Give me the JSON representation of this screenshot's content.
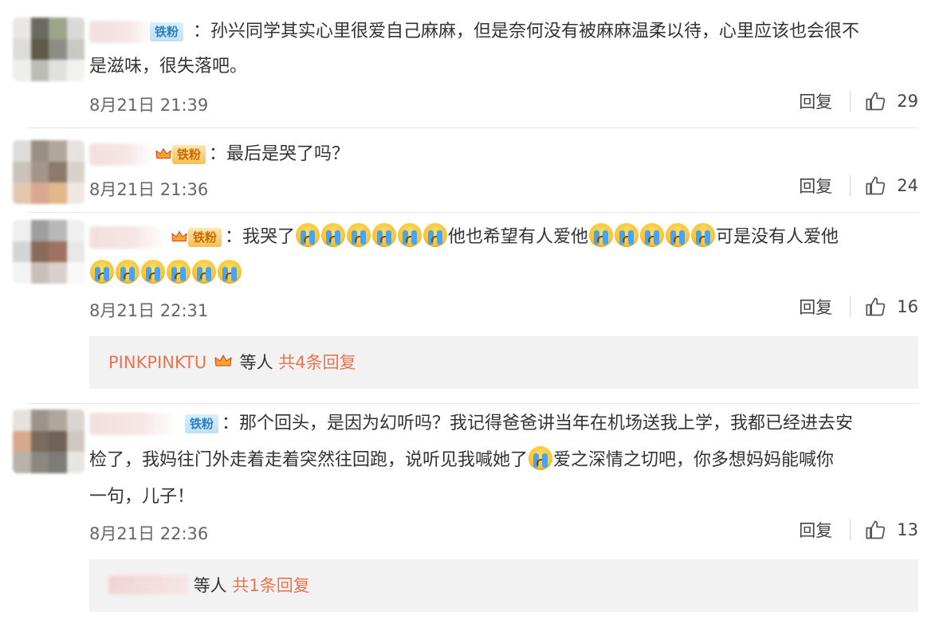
{
  "comments": [
    {
      "badge": "铁粉",
      "text_parts": [
        "孙兴同学其实心里很爱自己麻麻，但是奈何没有被麻麻温柔以待，心里应该也会很不",
        "是滋味，很失落吧。"
      ],
      "time": "8月21日 21:39",
      "reply": "回复",
      "likes": "29"
    },
    {
      "badge": "铁粉",
      "text_parts": [
        "最后是哭了吗？"
      ],
      "time": "8月21日 21:36",
      "reply": "回复",
      "likes": "24"
    },
    {
      "badge": "铁粉",
      "text_parts": [
        "我哭了",
        "他也希望有人爱他",
        "可是没有人爱他"
      ],
      "time": "8月21日 22:31",
      "reply": "回复",
      "likes": "16",
      "subreplies": {
        "user": "PINKPINKTU",
        "etc": "等人",
        "total": "共4条回复"
      }
    },
    {
      "badge": "铁粉",
      "text_parts": [
        "那个回头，是因为幻听吗？我记得爸爸讲当年在机场送我上学，我都已经进去安",
        "检了，我妈往门外走着走着突然往回跑，说听见我喊她了",
        "爱之深情之切吧，你多想妈妈能喊你",
        "一句，儿子！"
      ],
      "time": "8月21日 22:36",
      "reply": "回复",
      "likes": "13",
      "subreplies": {
        "etc": "等人",
        "total": "共1条回复"
      }
    }
  ],
  "colon": "：",
  "icons": {
    "like": "thumbs-up-icon",
    "crying_emoji": "crying-face-icon",
    "crown": "crown-icon"
  },
  "colors": {
    "link": "#eb7350",
    "badge_blue": "#2e7fbf",
    "badge_gold": "#c76a00"
  }
}
